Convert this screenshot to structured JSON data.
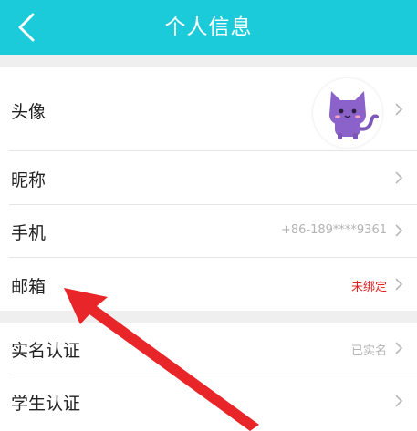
{
  "header": {
    "title": "个人信息",
    "background": "#1ccbda"
  },
  "rows": {
    "avatar": {
      "label": "头像"
    },
    "nickname": {
      "label": "昵称",
      "value": ""
    },
    "phone": {
      "label": "手机",
      "value": "+86-189****9361"
    },
    "email": {
      "label": "邮箱",
      "value": "未绑定",
      "value_color": "#e0201f"
    },
    "realname": {
      "label": "实名认证",
      "value": "已实名"
    },
    "student": {
      "label": "学生认证",
      "value": ""
    }
  },
  "icons": {
    "back": "chevron-left-icon",
    "row_arrow": "chevron-right-icon",
    "avatar": "purple-cat-avatar"
  },
  "annotation": {
    "type": "red arrow pointing to email row",
    "color": "#e8262a"
  }
}
